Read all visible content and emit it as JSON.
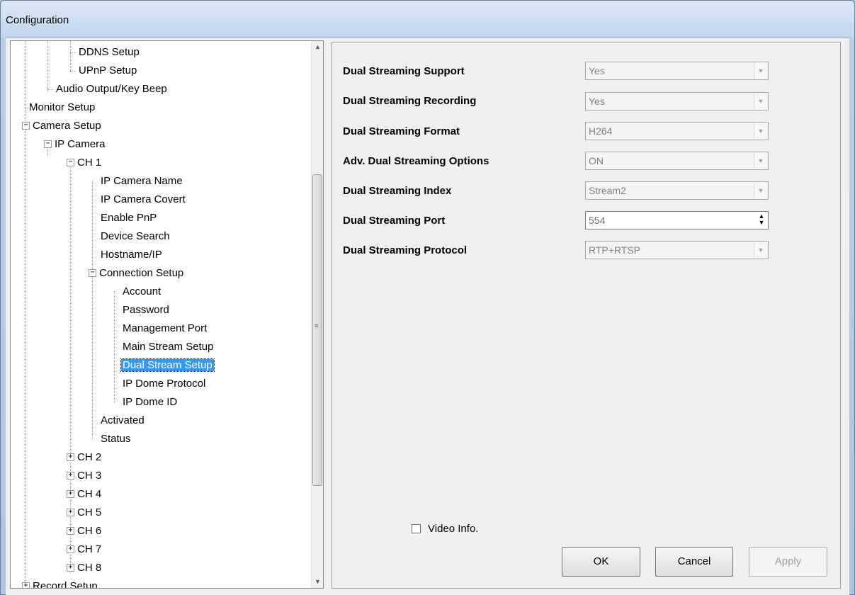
{
  "window": {
    "title": "Configuration"
  },
  "tree": {
    "items": [
      "DDNS Setup",
      "UPnP Setup",
      "Audio Output/Key Beep",
      "Monitor Setup",
      "Camera Setup",
      "IP Camera",
      "CH 1",
      "IP Camera Name",
      "IP Camera Covert",
      "Enable PnP",
      "Device Search",
      "Hostname/IP",
      "Connection Setup",
      "Account",
      "Password",
      "Management Port",
      "Main Stream Setup",
      "Dual Stream Setup",
      "IP Dome Protocol",
      "IP Dome ID",
      "Activated",
      "Status",
      "CH 2",
      "CH 3",
      "CH 4",
      "CH 5",
      "CH 6",
      "CH 7",
      "CH 8",
      "Record Setup"
    ],
    "selected": "Dual Stream Setup"
  },
  "settings": {
    "rows": [
      {
        "label": "Dual Streaming Support",
        "value": "Yes"
      },
      {
        "label": "Dual Streaming Recording",
        "value": "Yes"
      },
      {
        "label": "Dual Streaming Format",
        "value": "H264"
      },
      {
        "label": "Adv. Dual Streaming Options",
        "value": "ON"
      },
      {
        "label": "Dual Streaming Index",
        "value": "Stream2"
      },
      {
        "label": "Dual Streaming Port",
        "value": "554"
      },
      {
        "label": "Dual Streaming Protocol",
        "value": "RTP+RTSP"
      }
    ]
  },
  "video_info": {
    "label": "Video Info.",
    "checked": false
  },
  "buttons": {
    "ok": "OK",
    "cancel": "Cancel",
    "apply": "Apply"
  }
}
